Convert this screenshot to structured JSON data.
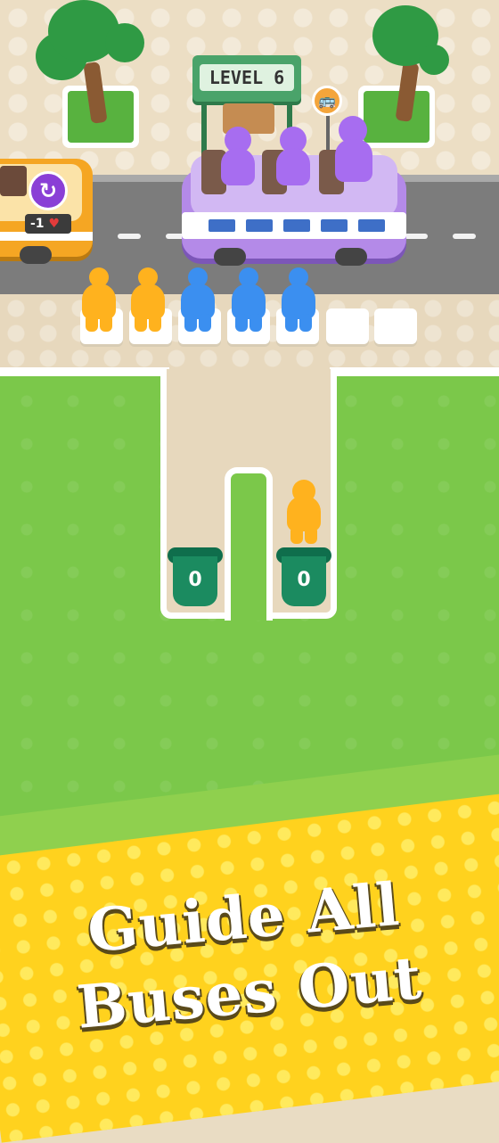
{
  "level": {
    "label": "LEVEL 6"
  },
  "bus_stop_sign": {
    "icon": "bus-stop-icon"
  },
  "left_bus": {
    "badge_text": "-1",
    "refresh_icon": "refresh-icon",
    "heart_icon": "heart-icon"
  },
  "passenger_slots": {
    "queue": [
      "yellow",
      "yellow",
      "blue",
      "blue",
      "blue",
      "empty",
      "empty"
    ]
  },
  "boarded_passengers": [
    "purple",
    "purple",
    "purple"
  ],
  "bins": [
    {
      "count": "0"
    },
    {
      "count": "0"
    }
  ],
  "waiting_passenger": {
    "color": "yellow"
  },
  "promo": {
    "line1": "Guide All",
    "line2": "Buses Out"
  },
  "colors": {
    "grass": "#7bc84a",
    "road": "#7c7c7c",
    "bus_purple": "#b48ae8",
    "bus_orange": "#f5a623",
    "bin_green": "#1b8b60",
    "banner_yellow": "#ffd21e",
    "yellow_person": "#ffb21e",
    "blue_person": "#3b8ff0"
  }
}
